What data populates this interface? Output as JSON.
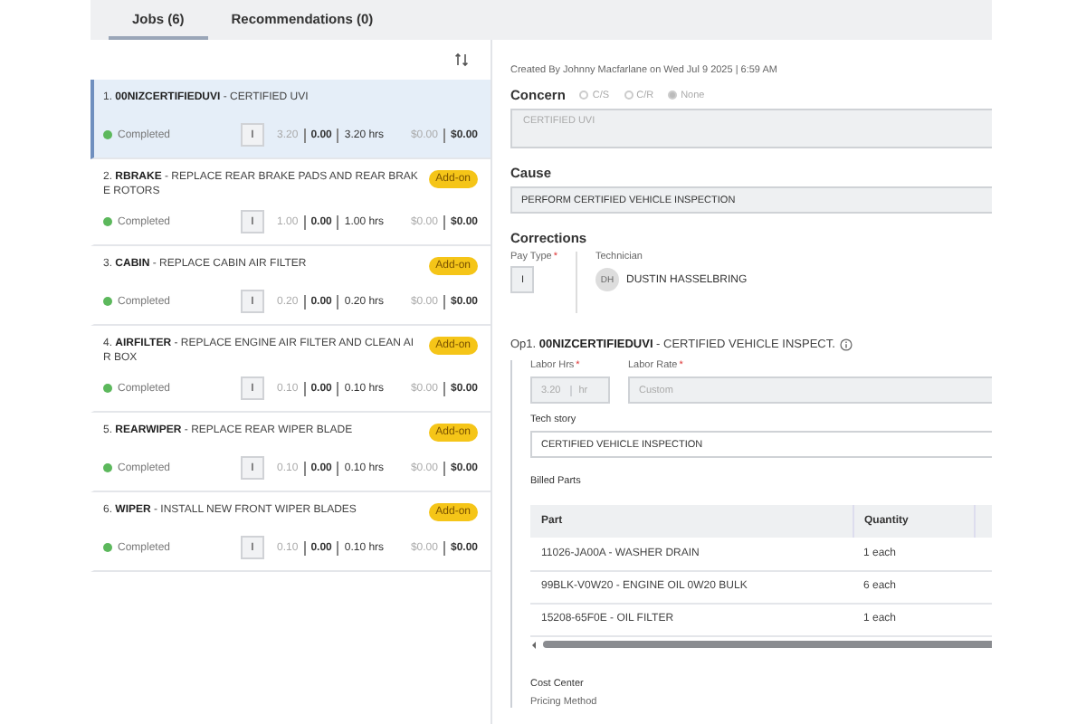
{
  "tabs": [
    {
      "label": "Jobs (6)",
      "selected": true
    },
    {
      "label": "Recommendations (0)",
      "selected": false
    }
  ],
  "jobs": [
    {
      "title": "1. **00NIZCERTIFIEDUVI** - CERTIFIED UVI",
      "selected": true,
      "status": "Completed",
      "pay_type": "I",
      "hours": [
        "3.20",
        "0.00",
        "3.20 hrs"
      ],
      "amounts": [
        "$0.00",
        "$0.00"
      ]
    },
    {
      "title": "2. **RBRAKE** - REPLACE REAR BRAKE PADS AND REAR BRAKE ROTORS",
      "selected": false,
      "badge": "Add-on",
      "status": "Completed",
      "pay_type": "I",
      "hours": [
        "1.00",
        "0.00",
        "1.00 hrs"
      ],
      "amounts": [
        "$0.00",
        "$0.00"
      ]
    },
    {
      "title": "3. **CABIN** - REPLACE CABIN AIR FILTER",
      "selected": false,
      "badge": "Add-on",
      "status": "Completed",
      "pay_type": "I",
      "hours": [
        "0.20",
        "0.00",
        "0.20 hrs"
      ],
      "amounts": [
        "$0.00",
        "$0.00"
      ]
    },
    {
      "title": "4. **AIRFILTER** - REPLACE ENGINE AIR FILTER AND CLEAN AIR BOX",
      "selected": false,
      "badge": "Add-on",
      "status": "Completed",
      "pay_type": "I",
      "hours": [
        "0.10",
        "0.00",
        "0.10 hrs"
      ],
      "amounts": [
        "$0.00",
        "$0.00"
      ]
    },
    {
      "title": "5. **REARWIPER** - REPLACE REAR WIPER BLADE",
      "selected": false,
      "badge": "Add-on",
      "status": "Completed",
      "pay_type": "I",
      "hours": [
        "0.10",
        "0.00",
        "0.10 hrs"
      ],
      "amounts": [
        "$0.00",
        "$0.00"
      ]
    },
    {
      "title": "6. **WIPER** - INSTALL NEW FRONT WIPER BLADES",
      "selected": false,
      "badge": "Add-on",
      "status": "Completed",
      "pay_type": "I",
      "hours": [
        "0.10",
        "0.00",
        "0.10 hrs"
      ],
      "amounts": [
        "$0.00",
        "$0.00"
      ]
    }
  ],
  "detail": {
    "created": "Created By Johnny Macfarlane on Wed Jul 9 2025 | 6:59 AM",
    "concern": {
      "label": "Concern",
      "options": [
        {
          "label": "C/S",
          "selected": false
        },
        {
          "label": "C/R",
          "selected": false
        },
        {
          "label": "None",
          "selected": true
        }
      ],
      "value": "CERTIFIED UVI"
    },
    "cause": {
      "label": "Cause",
      "value": "PERFORM CERTIFIED VEHICLE INSPECTION"
    },
    "corrections": {
      "label": "Corrections",
      "pay_type_label": "Pay Type",
      "required_mark": "*",
      "pay_type": "I",
      "technician_label": "Technician",
      "technician_initials": "DH",
      "technician": "DUSTIN HASSELBRING"
    },
    "operation": {
      "title": "Op1. **00NIZCERTIFIEDUVI** - CERTIFIED VEHICLE INSPECT.",
      "labor_hrs_label": "Labor Hrs",
      "labor_hrs": "3.20",
      "labor_hrs_unit": "hr",
      "labor_rate_label": "Labor Rate",
      "labor_rate": "Custom",
      "tech_story_label": "Tech story",
      "tech_story": "CERTIFIED VEHICLE INSPECTION",
      "billed_parts": {
        "title": "Billed Parts",
        "columns": [
          "Part",
          "Quantity"
        ],
        "rows": [
          [
            "11026-JA00A - WASHER DRAIN",
            "1 each"
          ],
          [
            "99BLK-V0W20 - ENGINE OIL 0W20 BULK",
            "6 each"
          ],
          [
            "15208-65F0E - OIL FILTER",
            "1 each"
          ]
        ]
      },
      "cost_center": "Cost Center",
      "pricing_method": "Pricing Method"
    }
  }
}
